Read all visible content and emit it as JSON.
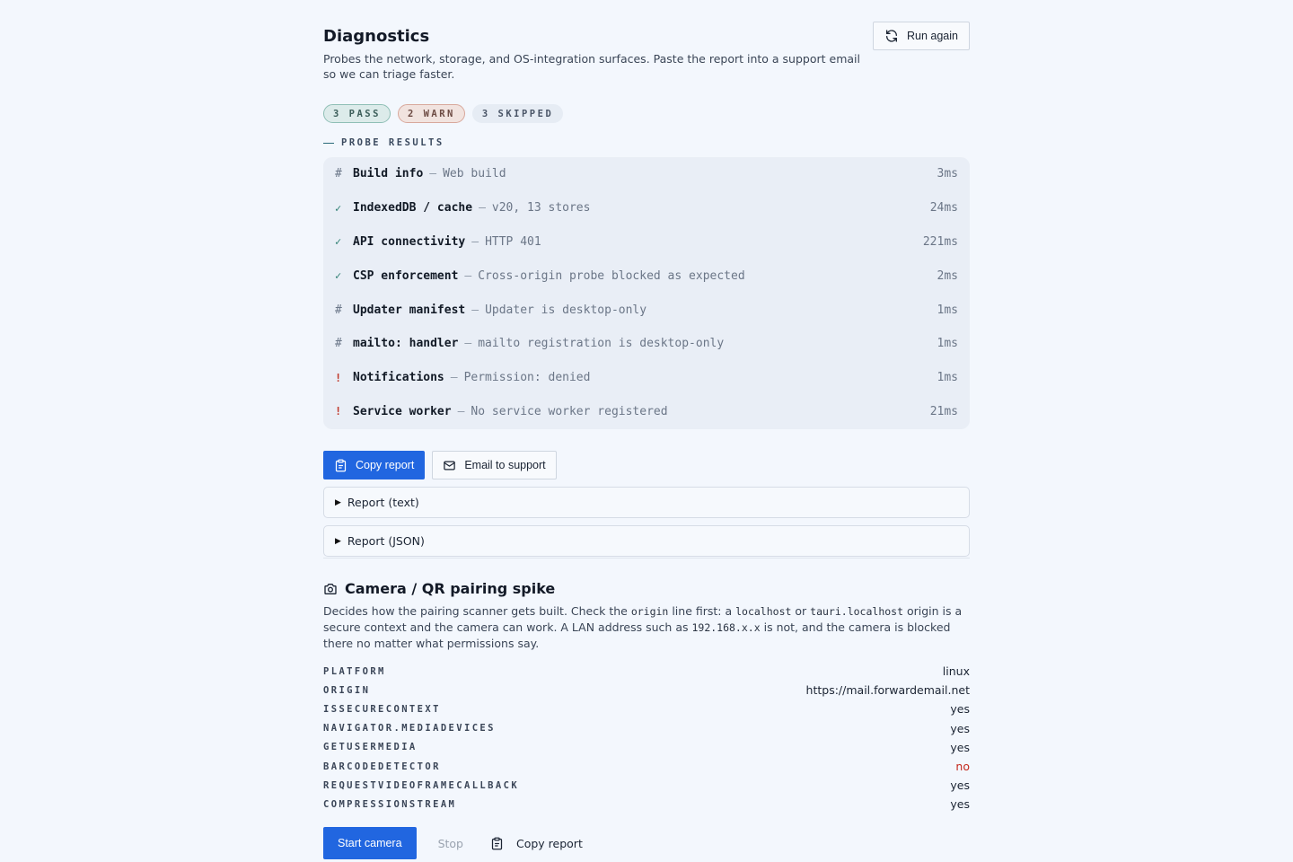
{
  "header": {
    "title": "Diagnostics",
    "description": "Probes the network, storage, and OS-integration surfaces. Paste the report into a support email so we can triage faster.",
    "run_again_label": "Run again"
  },
  "badges": {
    "pass": "3 PASS",
    "warn": "2 WARN",
    "skipped": "3 SKIPPED"
  },
  "section_label": "PROBE RESULTS",
  "probes": [
    {
      "status": "#",
      "name": "Build info",
      "detail": "Web build",
      "duration": "3ms"
    },
    {
      "status": "✓",
      "name": "IndexedDB / cache",
      "detail": "v20, 13 stores",
      "duration": "24ms"
    },
    {
      "status": "✓",
      "name": "API connectivity",
      "detail": "HTTP 401",
      "duration": "221ms"
    },
    {
      "status": "✓",
      "name": "CSP enforcement",
      "detail": "Cross-origin probe blocked as expected",
      "duration": "2ms"
    },
    {
      "status": "#",
      "name": "Updater manifest",
      "detail": "Updater is desktop-only",
      "duration": "1ms"
    },
    {
      "status": "#",
      "name": "mailto: handler",
      "detail": "mailto registration is desktop-only",
      "duration": "1ms"
    },
    {
      "status": "!",
      "name": "Notifications",
      "detail": "Permission: denied",
      "duration": "1ms"
    },
    {
      "status": "!",
      "name": "Service worker",
      "detail": "No service worker registered",
      "duration": "21ms"
    }
  ],
  "separator": "—",
  "actions": {
    "copy_report": "Copy report",
    "email_support": "Email to support"
  },
  "disclosures": {
    "text": "Report (text)",
    "json": "Report (JSON)"
  },
  "camera": {
    "title": "Camera / QR pairing spike",
    "desc": {
      "p1": "Decides how the pairing scanner gets built. Check the ",
      "c1": "origin",
      "p2": " line first: a ",
      "c2": "localhost",
      "p3": " or ",
      "c3": "tauri.localhost",
      "p4": " origin is a secure context and the camera can work. A LAN address such as ",
      "c4": "192.168.x.x",
      "p5": " is not, and the camera is blocked there no matter what permissions say."
    },
    "rows": [
      {
        "key": "PLATFORM",
        "value": "linux"
      },
      {
        "key": "ORIGIN",
        "value": "https://mail.forwardemail.net"
      },
      {
        "key": "ISSECURECONTEXT",
        "value": "yes"
      },
      {
        "key": "NAVIGATOR.MEDIADEVICES",
        "value": "yes"
      },
      {
        "key": "GETUSERMEDIA",
        "value": "yes"
      },
      {
        "key": "BARCODEDETECTOR",
        "value": "no"
      },
      {
        "key": "REQUESTVIDEOFRAMECALLBACK",
        "value": "yes"
      },
      {
        "key": "COMPRESSIONSTREAM",
        "value": "yes"
      }
    ],
    "start_label": "Start camera",
    "stop_label": "Stop",
    "copy_label": "Copy report"
  },
  "colors": {
    "accent": "#2166e0",
    "pass": "#2e7f73",
    "warn": "#c0392b",
    "negative": "#c4281d"
  }
}
